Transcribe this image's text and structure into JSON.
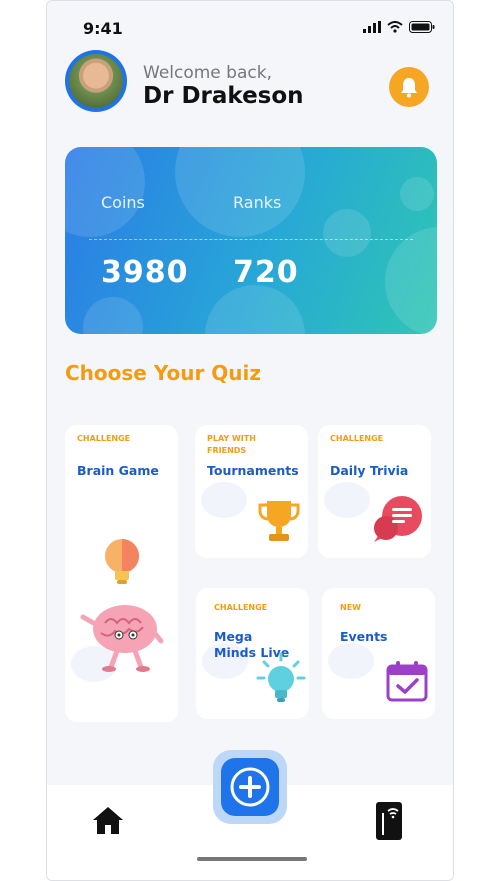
{
  "status_bar": {
    "time": "9:41"
  },
  "header": {
    "welcome": "Welcome back,",
    "user_name": "Dr Drakeson"
  },
  "stats": {
    "coins_label": "Coins",
    "coins_value": "3980",
    "ranks_label": "Ranks",
    "ranks_value": "720"
  },
  "section_title": "Choose Your Quiz",
  "quizzes": [
    {
      "tag": "CHALLENGE",
      "title": "Brain Game",
      "icon": "brain-icon"
    },
    {
      "tag": "PLAY WITH FRIENDS",
      "title": "Tournaments",
      "icon": "trophy-icon"
    },
    {
      "tag": "CHALLENGE",
      "title": "Daily Trivia",
      "icon": "chat-icon"
    },
    {
      "tag": "CHALLENGE",
      "title": "Mega Minds Live",
      "icon": "lightbulb-icon"
    },
    {
      "tag": "NEW",
      "title": "Events",
      "icon": "calendar-icon"
    }
  ],
  "nav": {
    "items": [
      "home-icon",
      "plus-icon",
      "phone-icon"
    ]
  },
  "colors": {
    "accent": "#1e74e8",
    "orange": "#f39c12",
    "bell": "#f5a623"
  }
}
